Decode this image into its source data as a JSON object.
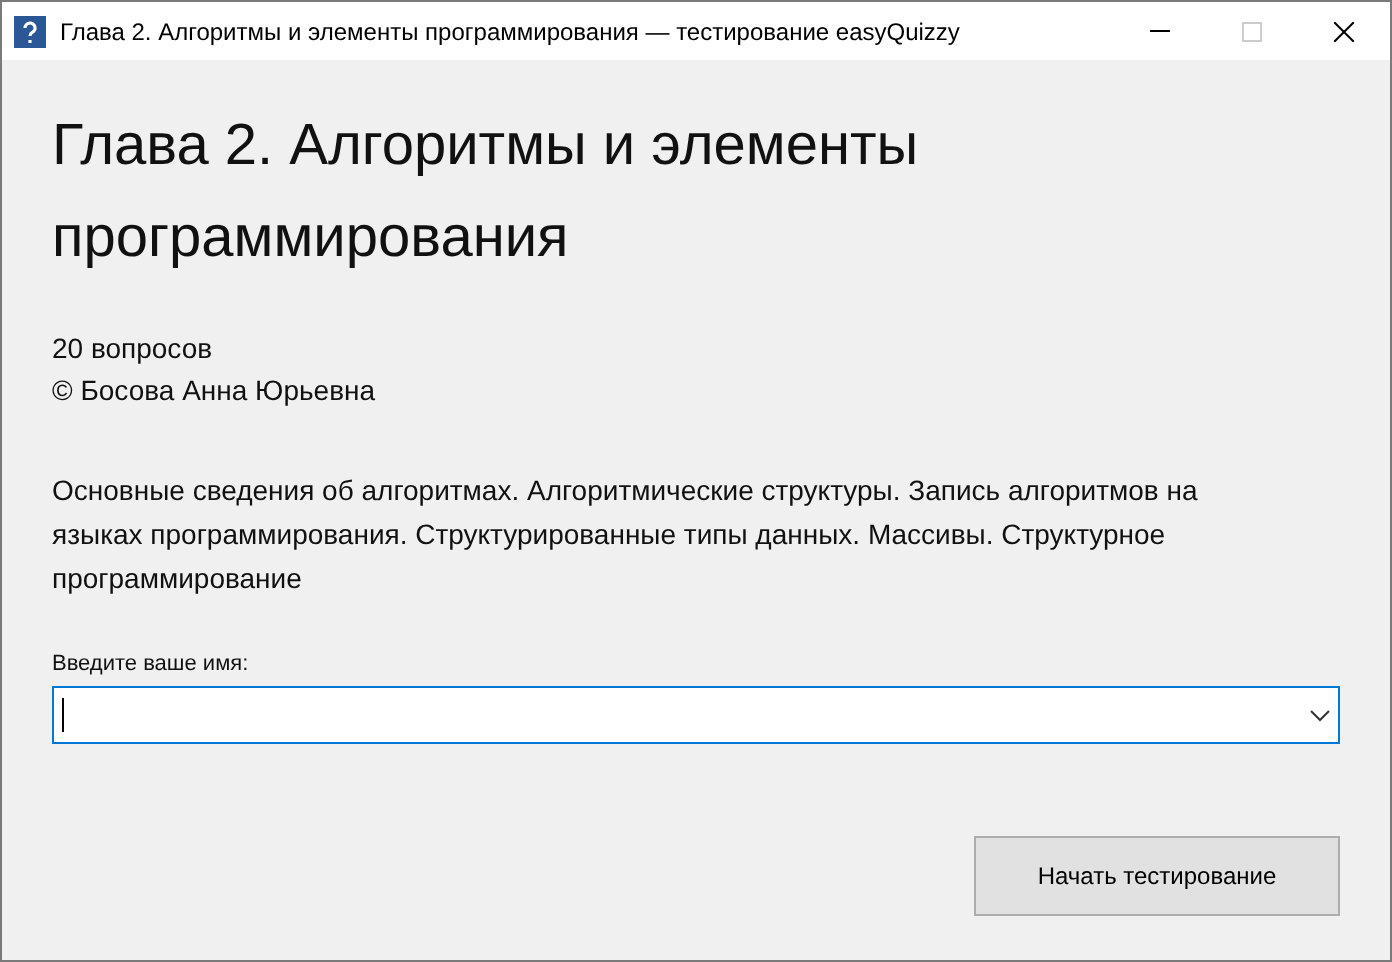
{
  "window": {
    "title": "Глава 2. Алгоритмы и элементы программирования — тестирование easyQuizzy"
  },
  "heading": "Глава 2. Алгоритмы и элементы программирования",
  "question_count": "20 вопросов",
  "author": "© Босова Анна Юрьевна",
  "description": "Основные сведения об алгоритмах. Алгоритмические структуры. Запись алгоритмов на языках программирования. Структурированные типы данных. Массивы. Структурное программирование",
  "name_field": {
    "label": "Введите ваше имя:",
    "focused": true
  },
  "start_button": "Начать тестирование"
}
